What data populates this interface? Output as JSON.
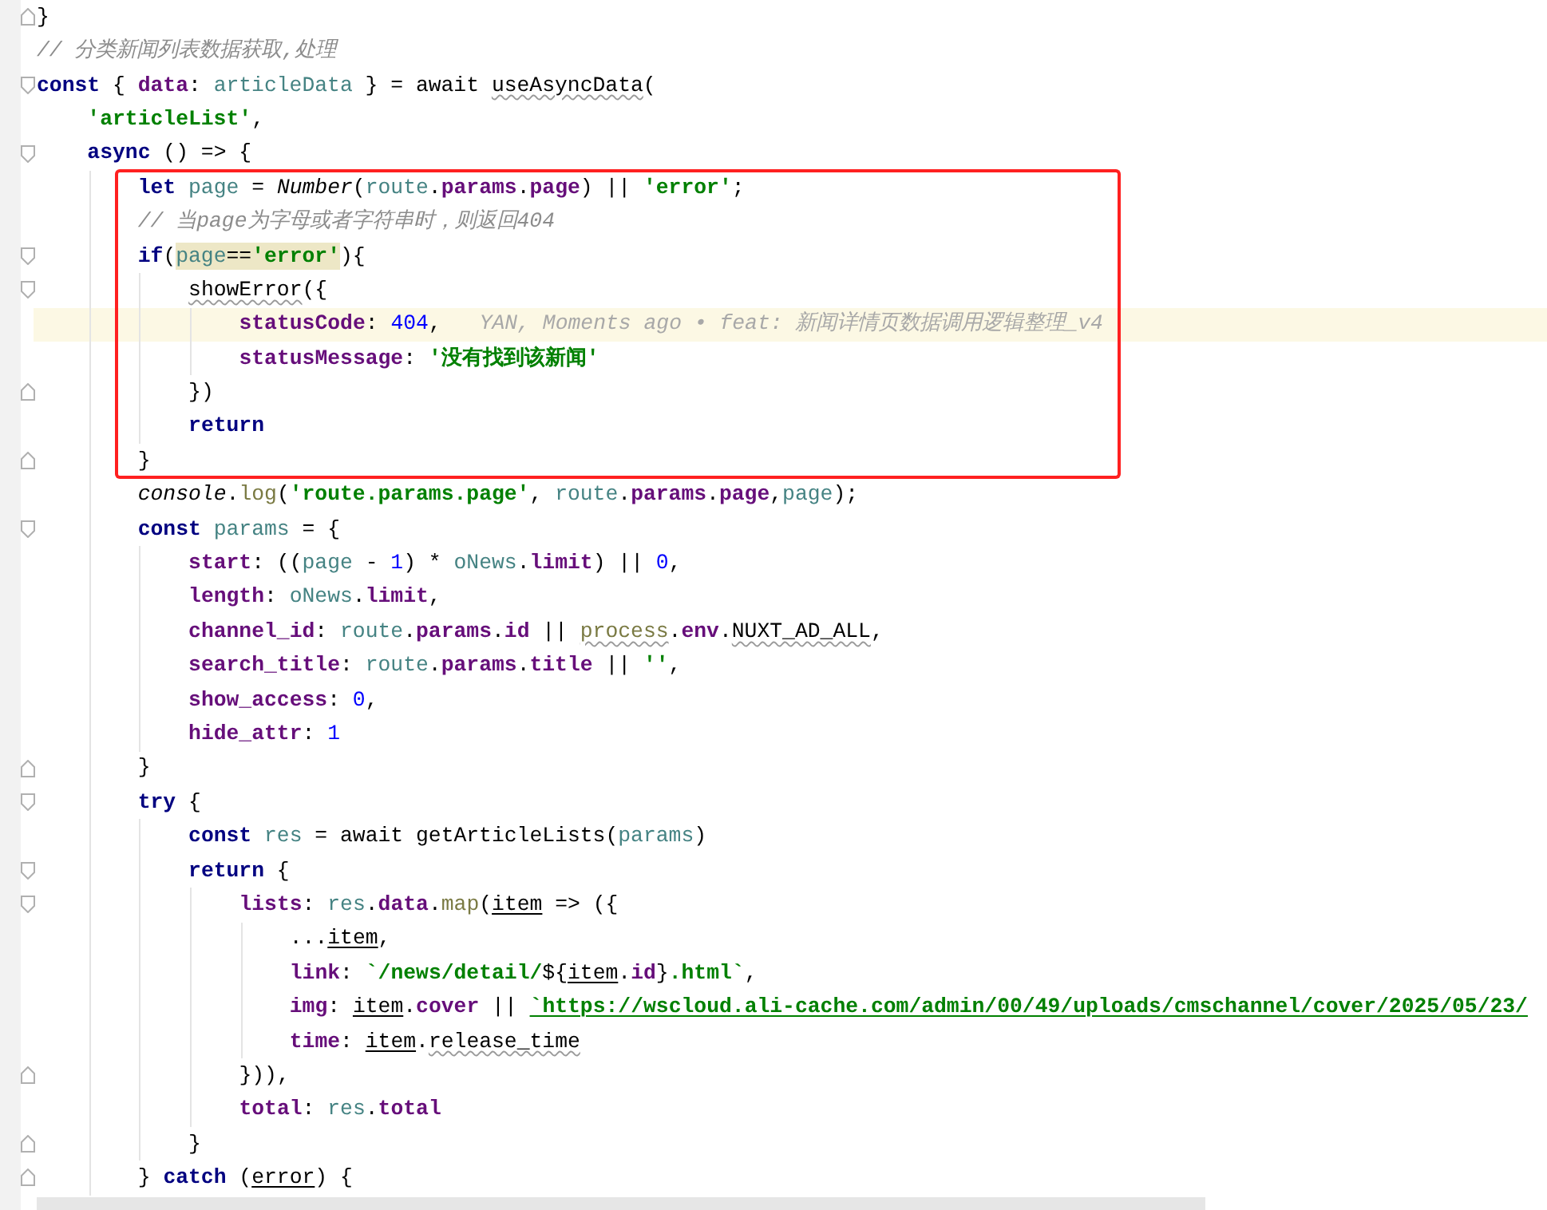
{
  "lines": [
    {
      "kind": "fold-end",
      "tokens": [
        {
          "text": "}",
          "kind": "plain"
        }
      ]
    },
    {
      "kind": "plain",
      "tokens": [
        {
          "text": "// 分类新闻列表数据获取,处理",
          "kind": "comment"
        }
      ]
    },
    {
      "kind": "fold-start",
      "tokens": [
        {
          "text": "const",
          "kind": "keyword"
        },
        {
          "text": " { ",
          "kind": "plain"
        },
        {
          "text": "data",
          "kind": "property"
        },
        {
          "text": ": ",
          "kind": "plain"
        },
        {
          "text": "articleData",
          "kind": "local"
        },
        {
          "text": " } = await ",
          "kind": "plain"
        },
        {
          "text": "useAsyncData",
          "kind": "warning"
        },
        {
          "text": "(",
          "kind": "plain"
        }
      ],
      "children": [
        {
          "kind": "plain",
          "tokens": [
            {
              "text": "'articleList'",
              "kind": "string"
            },
            {
              "text": ",",
              "kind": "plain"
            }
          ]
        },
        {
          "kind": "fold-start",
          "tokens": [
            {
              "text": "async",
              "kind": "keyword"
            },
            {
              "text": " () => {",
              "kind": "plain"
            }
          ],
          "children": [
            {
              "kind": "plain",
              "boxed": true,
              "tokens": [
                {
                  "text": "let",
                  "kind": "keyword"
                },
                {
                  "text": " page",
                  "kind": "local"
                },
                {
                  "text": " = ",
                  "kind": "plain"
                },
                {
                  "text": "Number",
                  "kind": "global"
                },
                {
                  "text": "(",
                  "kind": "plain"
                },
                {
                  "text": "route",
                  "kind": "local"
                },
                {
                  "text": ".",
                  "kind": "plain"
                },
                {
                  "text": "params",
                  "kind": "property"
                },
                {
                  "text": ".",
                  "kind": "plain"
                },
                {
                  "text": "page",
                  "kind": "property"
                },
                {
                  "text": ") || ",
                  "kind": "plain"
                },
                {
                  "text": "'error'",
                  "kind": "string"
                },
                {
                  "text": ";",
                  "kind": "plain"
                }
              ]
            },
            {
              "kind": "plain",
              "boxed": true,
              "tokens": [
                {
                  "text": "// 当page为字母或者字符串时，则返回404",
                  "kind": "comment"
                }
              ]
            },
            {
              "kind": "fold-start",
              "boxed": true,
              "tokens": [
                {
                  "text": "if",
                  "kind": "keyword"
                },
                {
                  "text": "(",
                  "kind": "plain"
                },
                {
                  "text": "page",
                  "kind": "local",
                  "matched": true
                },
                {
                  "text": "==",
                  "kind": "plain",
                  "matched": true
                },
                {
                  "text": "'error'",
                  "kind": "string",
                  "matched": true
                },
                {
                  "text": "){",
                  "kind": "plain"
                }
              ],
              "children": [
                {
                  "kind": "fold-start",
                  "boxed": true,
                  "tokens": [
                    {
                      "text": "showError",
                      "kind": "warning"
                    },
                    {
                      "text": "({",
                      "kind": "plain"
                    }
                  ],
                  "children": [
                    {
                      "kind": "plain",
                      "boxed": true,
                      "current": true,
                      "blame": "YAN, Moments ago • feat: 新闻详情页数据调用逻辑整理_v4",
                      "tokens": [
                        {
                          "text": "statusCode",
                          "kind": "property"
                        },
                        {
                          "text": ": ",
                          "kind": "plain"
                        },
                        {
                          "text": "404",
                          "kind": "number"
                        },
                        {
                          "text": ",",
                          "kind": "plain"
                        }
                      ]
                    },
                    {
                      "kind": "plain",
                      "boxed": true,
                      "tokens": [
                        {
                          "text": "statusMessage",
                          "kind": "property"
                        },
                        {
                          "text": ": ",
                          "kind": "plain"
                        },
                        {
                          "text": "'没有找到该新闻'",
                          "kind": "string"
                        }
                      ]
                    }
                  ]
                },
                {
                  "kind": "fold-end",
                  "boxed": true,
                  "tokens": [
                    {
                      "text": "})",
                      "kind": "plain"
                    }
                  ]
                },
                {
                  "kind": "plain",
                  "boxed": true,
                  "tokens": [
                    {
                      "text": "return",
                      "kind": "keyword"
                    }
                  ]
                }
              ]
            },
            {
              "kind": "fold-end",
              "boxed": true,
              "tokens": [
                {
                  "text": "}",
                  "kind": "plain"
                }
              ]
            },
            {
              "kind": "plain",
              "tokens": [
                {
                  "text": "console",
                  "kind": "global"
                },
                {
                  "text": ".",
                  "kind": "plain"
                },
                {
                  "text": "log",
                  "kind": "method"
                },
                {
                  "text": "(",
                  "kind": "plain"
                },
                {
                  "text": "'route.params.page'",
                  "kind": "string"
                },
                {
                  "text": ", ",
                  "kind": "plain"
                },
                {
                  "text": "route",
                  "kind": "local"
                },
                {
                  "text": ".",
                  "kind": "plain"
                },
                {
                  "text": "params",
                  "kind": "property"
                },
                {
                  "text": ".",
                  "kind": "plain"
                },
                {
                  "text": "page",
                  "kind": "property"
                },
                {
                  "text": ",",
                  "kind": "plain"
                },
                {
                  "text": "page",
                  "kind": "local"
                },
                {
                  "text": ");",
                  "kind": "plain"
                }
              ]
            },
            {
              "kind": "fold-start",
              "tokens": [
                {
                  "text": "const",
                  "kind": "keyword"
                },
                {
                  "text": " params",
                  "kind": "local"
                },
                {
                  "text": " = {",
                  "kind": "plain"
                }
              ],
              "children": [
                {
                  "kind": "plain",
                  "tokens": [
                    {
                      "text": "start",
                      "kind": "property"
                    },
                    {
                      "text": ": ((",
                      "kind": "plain"
                    },
                    {
                      "text": "page",
                      "kind": "local"
                    },
                    {
                      "text": " - ",
                      "kind": "plain"
                    },
                    {
                      "text": "1",
                      "kind": "number"
                    },
                    {
                      "text": ") * ",
                      "kind": "plain"
                    },
                    {
                      "text": "oNews",
                      "kind": "local"
                    },
                    {
                      "text": ".",
                      "kind": "plain"
                    },
                    {
                      "text": "limit",
                      "kind": "property"
                    },
                    {
                      "text": ") || ",
                      "kind": "plain"
                    },
                    {
                      "text": "0",
                      "kind": "number"
                    },
                    {
                      "text": ",",
                      "kind": "plain"
                    }
                  ]
                },
                {
                  "kind": "plain",
                  "tokens": [
                    {
                      "text": "length",
                      "kind": "property"
                    },
                    {
                      "text": ": ",
                      "kind": "plain"
                    },
                    {
                      "text": "oNews",
                      "kind": "local"
                    },
                    {
                      "text": ".",
                      "kind": "plain"
                    },
                    {
                      "text": "limit",
                      "kind": "property"
                    },
                    {
                      "text": ",",
                      "kind": "plain"
                    }
                  ]
                },
                {
                  "kind": "plain",
                  "tokens": [
                    {
                      "text": "channel_id",
                      "kind": "property"
                    },
                    {
                      "text": ": ",
                      "kind": "plain"
                    },
                    {
                      "text": "route",
                      "kind": "local"
                    },
                    {
                      "text": ".",
                      "kind": "plain"
                    },
                    {
                      "text": "params",
                      "kind": "property"
                    },
                    {
                      "text": ".",
                      "kind": "plain"
                    },
                    {
                      "text": "id",
                      "kind": "property"
                    },
                    {
                      "text": " || ",
                      "kind": "plain"
                    },
                    {
                      "text": "process",
                      "kind": "module-warning"
                    },
                    {
                      "text": ".",
                      "kind": "plain"
                    },
                    {
                      "text": "env",
                      "kind": "property"
                    },
                    {
                      "text": ".",
                      "kind": "plain"
                    },
                    {
                      "text": "NUXT_AD_ALL",
                      "kind": "warning"
                    },
                    {
                      "text": ",",
                      "kind": "plain"
                    }
                  ]
                },
                {
                  "kind": "plain",
                  "tokens": [
                    {
                      "text": "search_title",
                      "kind": "property"
                    },
                    {
                      "text": ": ",
                      "kind": "plain"
                    },
                    {
                      "text": "route",
                      "kind": "local"
                    },
                    {
                      "text": ".",
                      "kind": "plain"
                    },
                    {
                      "text": "params",
                      "kind": "property"
                    },
                    {
                      "text": ".",
                      "kind": "plain"
                    },
                    {
                      "text": "title",
                      "kind": "property"
                    },
                    {
                      "text": " || ",
                      "kind": "plain"
                    },
                    {
                      "text": "''",
                      "kind": "string"
                    },
                    {
                      "text": ",",
                      "kind": "plain"
                    }
                  ]
                },
                {
                  "kind": "plain",
                  "tokens": [
                    {
                      "text": "show_access",
                      "kind": "property"
                    },
                    {
                      "text": ": ",
                      "kind": "plain"
                    },
                    {
                      "text": "0",
                      "kind": "number"
                    },
                    {
                      "text": ",",
                      "kind": "plain"
                    }
                  ]
                },
                {
                  "kind": "plain",
                  "tokens": [
                    {
                      "text": "hide_attr",
                      "kind": "property"
                    },
                    {
                      "text": ": ",
                      "kind": "plain"
                    },
                    {
                      "text": "1",
                      "kind": "number"
                    }
                  ]
                }
              ]
            },
            {
              "kind": "fold-end",
              "tokens": [
                {
                  "text": "}",
                  "kind": "plain"
                }
              ]
            },
            {
              "kind": "fold-start",
              "tokens": [
                {
                  "text": "try",
                  "kind": "keyword"
                },
                {
                  "text": " {",
                  "kind": "plain"
                }
              ],
              "children": [
                {
                  "kind": "plain",
                  "tokens": [
                    {
                      "text": "const",
                      "kind": "keyword"
                    },
                    {
                      "text": " res",
                      "kind": "local"
                    },
                    {
                      "text": " = await getArticleLists(",
                      "kind": "plain"
                    },
                    {
                      "text": "params",
                      "kind": "local"
                    },
                    {
                      "text": ")",
                      "kind": "plain"
                    }
                  ]
                },
                {
                  "kind": "fold-start",
                  "tokens": [
                    {
                      "text": "return",
                      "kind": "keyword"
                    },
                    {
                      "text": " {",
                      "kind": "plain"
                    }
                  ],
                  "children": [
                    {
                      "kind": "fold-start",
                      "tokens": [
                        {
                          "text": "lists",
                          "kind": "property"
                        },
                        {
                          "text": ": ",
                          "kind": "plain"
                        },
                        {
                          "text": "res",
                          "kind": "local"
                        },
                        {
                          "text": ".",
                          "kind": "plain"
                        },
                        {
                          "text": "data",
                          "kind": "property"
                        },
                        {
                          "text": ".",
                          "kind": "plain"
                        },
                        {
                          "text": "map",
                          "kind": "method"
                        },
                        {
                          "text": "(",
                          "kind": "plain"
                        },
                        {
                          "text": "item",
                          "kind": "parameter"
                        },
                        {
                          "text": " => ({",
                          "kind": "plain"
                        }
                      ],
                      "children": [
                        {
                          "kind": "plain",
                          "tokens": [
                            {
                              "text": "...",
                              "kind": "plain"
                            },
                            {
                              "text": "item",
                              "kind": "parameter"
                            },
                            {
                              "text": ",",
                              "kind": "plain"
                            }
                          ]
                        },
                        {
                          "kind": "plain",
                          "tokens": [
                            {
                              "text": "link",
                              "kind": "property"
                            },
                            {
                              "text": ": ",
                              "kind": "plain"
                            },
                            {
                              "text": "`/news/detail/",
                              "kind": "string"
                            },
                            {
                              "text": "${",
                              "kind": "plain"
                            },
                            {
                              "text": "item",
                              "kind": "parameter"
                            },
                            {
                              "text": ".",
                              "kind": "plain"
                            },
                            {
                              "text": "id",
                              "kind": "property"
                            },
                            {
                              "text": "}",
                              "kind": "plain"
                            },
                            {
                              "text": ".html`",
                              "kind": "string"
                            },
                            {
                              "text": ",",
                              "kind": "plain"
                            }
                          ]
                        },
                        {
                          "kind": "plain",
                          "tokens": [
                            {
                              "text": "img",
                              "kind": "property"
                            },
                            {
                              "text": ": ",
                              "kind": "plain"
                            },
                            {
                              "text": "item",
                              "kind": "parameter"
                            },
                            {
                              "text": ".",
                              "kind": "plain"
                            },
                            {
                              "text": "cover",
                              "kind": "property"
                            },
                            {
                              "text": " || ",
                              "kind": "plain"
                            },
                            {
                              "text": "`https://wscloud.ali-cache.com/admin/00/49/uploads/cmschannel/cover/2025/05/23/",
                              "kind": "link"
                            }
                          ]
                        },
                        {
                          "kind": "plain",
                          "tokens": [
                            {
                              "text": "time",
                              "kind": "property"
                            },
                            {
                              "text": ": ",
                              "kind": "plain"
                            },
                            {
                              "text": "item",
                              "kind": "parameter"
                            },
                            {
                              "text": ".",
                              "kind": "plain"
                            },
                            {
                              "text": "release_time",
                              "kind": "warning"
                            }
                          ]
                        }
                      ]
                    },
                    {
                      "kind": "fold-end",
                      "tokens": [
                        {
                          "text": "})),",
                          "kind": "plain"
                        }
                      ]
                    },
                    {
                      "kind": "plain",
                      "tokens": [
                        {
                          "text": "total",
                          "kind": "property"
                        },
                        {
                          "text": ": ",
                          "kind": "plain"
                        },
                        {
                          "text": "res",
                          "kind": "local"
                        },
                        {
                          "text": ".",
                          "kind": "plain"
                        },
                        {
                          "text": "total",
                          "kind": "property"
                        }
                      ]
                    }
                  ]
                },
                {
                  "kind": "fold-end",
                  "tokens": [
                    {
                      "text": "}",
                      "kind": "plain"
                    }
                  ]
                }
              ]
            },
            {
              "kind": "fold-end",
              "tokens": [
                {
                  "text": "} ",
                  "kind": "plain"
                },
                {
                  "text": "catch",
                  "kind": "keyword"
                },
                {
                  "text": " (",
                  "kind": "plain"
                },
                {
                  "text": "error",
                  "kind": "parameter"
                },
                {
                  "text": ") {",
                  "kind": "plain"
                }
              ]
            }
          ]
        }
      ]
    }
  ]
}
